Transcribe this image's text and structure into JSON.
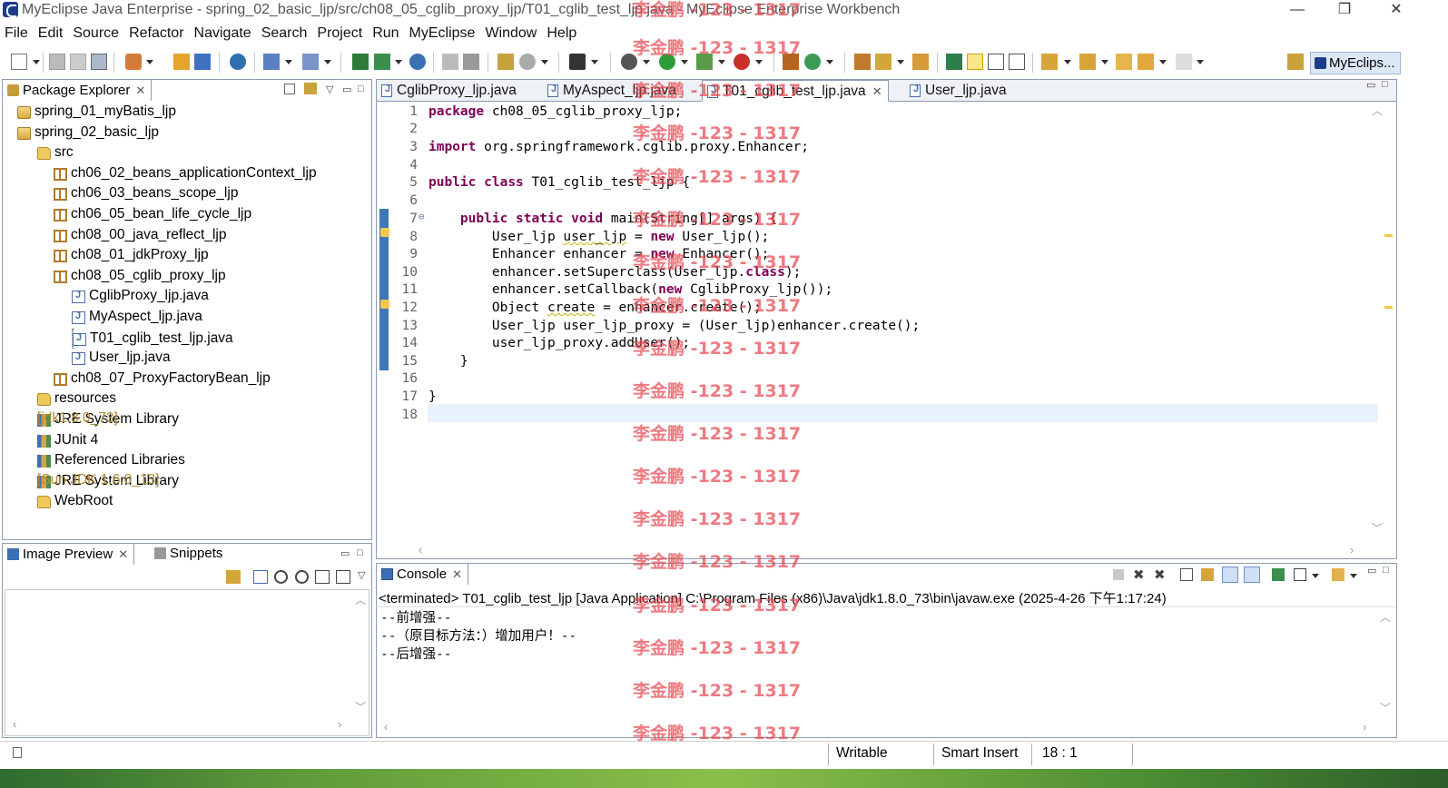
{
  "window": {
    "title": "MyEclipse Java Enterprise - spring_02_basic_ljp/src/ch08_05_cglib_proxy_ljp/T01_cglib_test_ljp.java - MyEclipse Enterprise Workbench",
    "minimize": "—",
    "restore": "❐",
    "close": "✕"
  },
  "menu": [
    "File",
    "Edit",
    "Source",
    "Refactor",
    "Navigate",
    "Search",
    "Project",
    "Run",
    "MyEclipse",
    "Window",
    "Help"
  ],
  "perspective": {
    "label": "MyEclips..."
  },
  "package_explorer": {
    "title": "Package Explorer",
    "items": [
      {
        "label": "spring_01_myBatis_ljp",
        "icon": "project-icon",
        "suffix": ""
      },
      {
        "label": "spring_02_basic_ljp",
        "icon": "project-icon",
        "suffix": ""
      },
      {
        "label": "src",
        "icon": "source-folder-icon",
        "suffix": ""
      },
      {
        "label": "ch06_02_beans_applicationContext_ljp",
        "icon": "package-icon",
        "suffix": ""
      },
      {
        "label": "ch06_03_beans_scope_ljp",
        "icon": "package-icon",
        "suffix": ""
      },
      {
        "label": "ch06_05_bean_life_cycle_ljp",
        "icon": "package-icon",
        "suffix": ""
      },
      {
        "label": "ch08_00_java_reflect_ljp",
        "icon": "package-icon",
        "suffix": ""
      },
      {
        "label": "ch08_01_jdkProxy_ljp",
        "icon": "package-icon",
        "suffix": ""
      },
      {
        "label": "ch08_05_cglib_proxy_ljp",
        "icon": "package-icon",
        "suffix": ""
      },
      {
        "label": "CglibProxy_ljp.java",
        "icon": "java-file-icon",
        "suffix": ""
      },
      {
        "label": "MyAspect_ljp.java",
        "icon": "java-file-icon",
        "suffix": ""
      },
      {
        "label": "T01_cglib_test_ljp.java",
        "icon": "java-file-icon",
        "suffix": ""
      },
      {
        "label": "User_ljp.java",
        "icon": "java-file-icon",
        "suffix": ""
      },
      {
        "label": "ch08_07_ProxyFactoryBean_ljp",
        "icon": "package-icon",
        "suffix": ""
      },
      {
        "label": "resources",
        "icon": "source-folder-icon",
        "suffix": ""
      },
      {
        "label": "JRE System Library ",
        "icon": "library-icon",
        "suffix": "[jdk1.8.0_73]"
      },
      {
        "label": "JUnit 4",
        "icon": "library-icon",
        "suffix": ""
      },
      {
        "label": "Referenced Libraries",
        "icon": "library-icon",
        "suffix": ""
      },
      {
        "label": "JRE System Library ",
        "icon": "library-icon",
        "suffix": "[Sun JDK 1.6.0_13]"
      },
      {
        "label": "WebRoot",
        "icon": "folder-icon",
        "suffix": ""
      }
    ]
  },
  "editor": {
    "tabs": [
      {
        "label": "CglibProxy_ljp.java"
      },
      {
        "label": "MyAspect_ljp.java"
      },
      {
        "label": "T01_cglib_test_ljp.java"
      },
      {
        "label": "User_ljp.java"
      }
    ],
    "line_numbers": [
      "1",
      "2",
      "3",
      "4",
      "5",
      "6",
      "7",
      "8",
      "9",
      "10",
      "11",
      "12",
      "13",
      "14",
      "15",
      "16",
      "17",
      "18"
    ],
    "fold_marker": "⊖"
  },
  "image_preview": {
    "title": "Image Preview",
    "snippets": "Snippets"
  },
  "console": {
    "title": "Console",
    "status": "<terminated> T01_cglib_test_ljp [Java Application] C:\\Program Files (x86)\\Java\\jdk1.8.0_73\\bin\\javaw.exe (2025-4-26 下午1:17:24)",
    "lines": [
      "--前增强--",
      "--（原目标方法：）增加用户！--",
      "--后增强--"
    ]
  },
  "status_bar": {
    "writable": "Writable",
    "insert_mode": "Smart Insert",
    "position": "18 : 1"
  },
  "watermark": "李金鹏 -123 - 1317"
}
